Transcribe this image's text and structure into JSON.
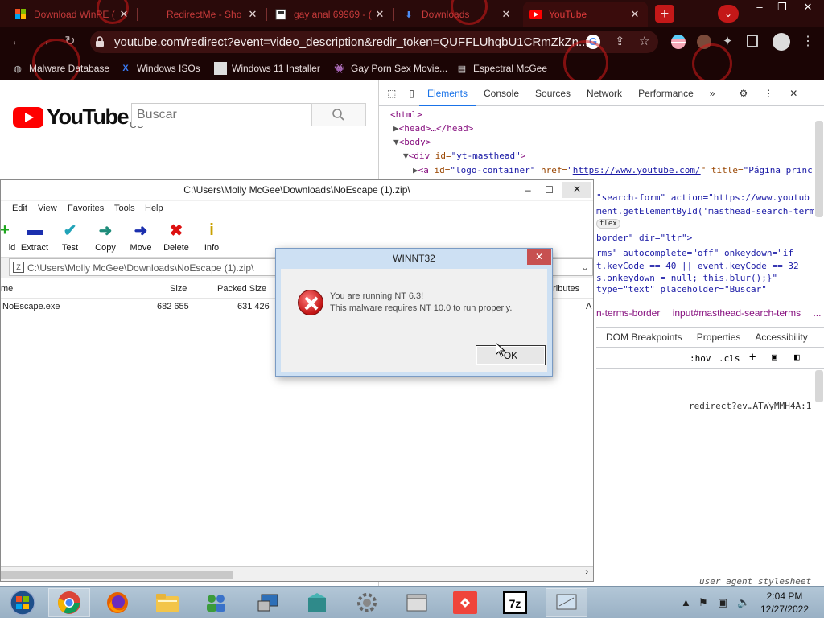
{
  "browser": {
    "tabs": [
      {
        "title": "Download WinPE (",
        "favicon": "windows-logo-icon",
        "active": false
      },
      {
        "title": "RedirectMe - Sho",
        "favicon": "none",
        "active": false
      },
      {
        "title": "gay anal 69969 - (",
        "favicon": "page-icon",
        "active": false
      },
      {
        "title": "Downloads",
        "favicon": "download-icon",
        "active": false
      },
      {
        "title": "YouTube",
        "favicon": "youtube-icon",
        "active": true
      }
    ],
    "new_tab_label": "+",
    "url": "youtube.com/redirect?event=video_description&redir_token=QUFFLUhqbU1CRmZkZn...",
    "bookmarks": [
      {
        "label": "Malware Database",
        "icon": "globe-icon"
      },
      {
        "label": "Windows ISOs",
        "icon": "x-icon"
      },
      {
        "label": "Windows 11 Installer",
        "icon": "image-icon"
      },
      {
        "label": "Gay Porn Sex Movie...",
        "icon": "alien-icon"
      },
      {
        "label": "Espectral McGee",
        "icon": "page-icon"
      }
    ]
  },
  "youtube": {
    "logo_word": "YouTube",
    "region": "CO",
    "search_placeholder": "Buscar"
  },
  "devtools": {
    "tabs": [
      "Elements",
      "Console",
      "Sources",
      "Network",
      "Performance",
      "»"
    ],
    "active_tab": "Elements",
    "dom": {
      "l1": "<html>",
      "l2": "<head>…</head>",
      "l3": "<body>",
      "l4_tag": "<div ",
      "l4_attr": "id=",
      "l4_val": "\"yt-masthead\"",
      "l4_end": ">",
      "l5_tag": "<a ",
      "l5_attr1": "id=",
      "l5_val1": "\"logo-container\"",
      "l5_attr2": " href=",
      "l5_link": "https://www.youtube.com/",
      "l5_attr3": "\" title=",
      "l5_val3": "\"Página princ",
      "l6": "\"search-form\" action=\"https://www.youtub",
      "l7": "ment.getElementById('masthead-search-term",
      "l8": "flex",
      "l9": "border\" dir=\"ltr\">",
      "l10": "rms\" autocomplete=\"off\" onkeydown=\"if",
      "l11": "t.keyCode == 40 || event.keyCode == 32",
      "l12": "s.onkeydown = null; this.blur();}\"",
      "l13": "type=\"text\" placeholder=\"Buscar\""
    },
    "breadcrumbs": [
      "n-terms-border",
      "input#masthead-search-terms",
      "..."
    ],
    "subtabs": [
      "DOM Breakpoints",
      "Properties",
      "Accessibility"
    ],
    "filter_hov": ":hov",
    "filter_cls": ".cls",
    "style_source": "redirect?ev…ATWyMMH4A:1",
    "ua_stylesheet": "user agent stylesheet"
  },
  "sevenzip": {
    "title": "C:\\Users\\Molly McGee\\Downloads\\NoEscape (1).zip\\",
    "menu": [
      "Edit",
      "View",
      "Favorites",
      "Tools",
      "Help"
    ],
    "tools": [
      {
        "label": "ld",
        "icon": "plus-icon"
      },
      {
        "label": "Extract",
        "icon": "minus-icon"
      },
      {
        "label": "Test",
        "icon": "check-icon"
      },
      {
        "label": "Copy",
        "icon": "copy-arrow-icon"
      },
      {
        "label": "Move",
        "icon": "move-arrow-icon"
      },
      {
        "label": "Delete",
        "icon": "delete-x-icon"
      },
      {
        "label": "Info",
        "icon": "info-icon"
      }
    ],
    "path": "C:\\Users\\Molly McGee\\Downloads\\NoEscape (1).zip\\",
    "columns": [
      "me",
      "Size",
      "Packed Size",
      "ttributes"
    ],
    "rows": [
      {
        "name": "NoEscape.exe",
        "size": "682 655",
        "packed": "631 426",
        "attr": "A"
      }
    ]
  },
  "dialog": {
    "title": "WINNT32",
    "line1": "You are running NT 6.3!",
    "line2": "This malware requires NT 10.0 to run properly.",
    "ok_label": "OK",
    "close_label": "✕"
  },
  "taskbar": {
    "apps": [
      "start-orb",
      "chrome",
      "firefox",
      "file-explorer",
      "network-users",
      "remote-desktop",
      "package",
      "settings-gear",
      "device-manager",
      "anydesk",
      "7zip",
      "display-settings"
    ],
    "time": "2:04 PM",
    "date": "12/27/2022"
  }
}
